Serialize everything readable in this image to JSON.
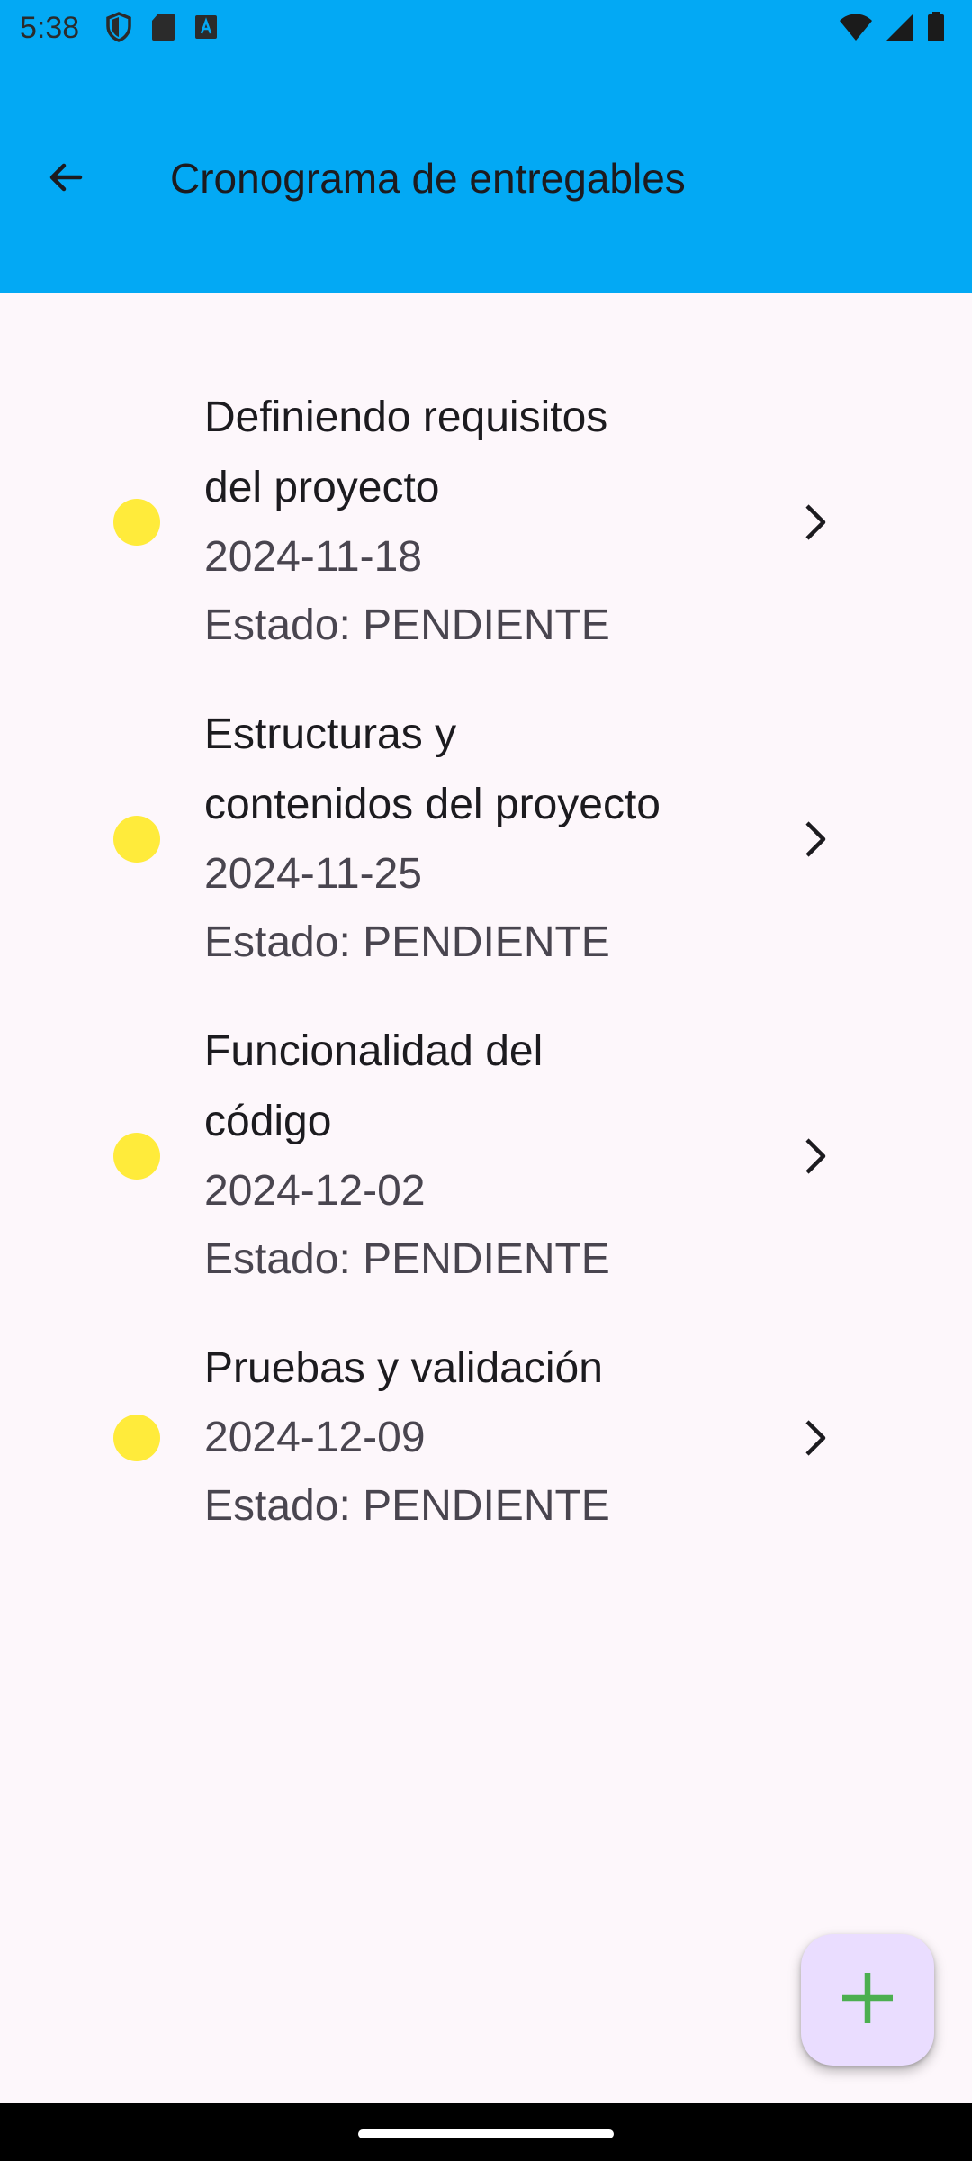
{
  "status_bar": {
    "time": "5:38",
    "left_icons": [
      "shield-icon",
      "sd-card-icon",
      "text-a-icon"
    ],
    "right_icons": [
      "wifi-icon",
      "cell-signal-icon",
      "battery-icon"
    ]
  },
  "app_bar": {
    "title": "Cronograma de entregables",
    "back_icon": "arrow-back-icon",
    "background_color": "#03a9f4"
  },
  "deliverables": [
    {
      "title_lines": [
        "Definiendo requisitos",
        "del proyecto"
      ],
      "date": "2024-11-18",
      "status": "Estado: PENDIENTE",
      "indicator_color": "#ffeb3b"
    },
    {
      "title_lines": [
        "Estructuras y",
        "contenidos del proyecto"
      ],
      "date": "2024-11-25",
      "status": "Estado: PENDIENTE",
      "indicator_color": "#ffeb3b"
    },
    {
      "title_lines": [
        "Funcionalidad del",
        "código"
      ],
      "date": "2024-12-02",
      "status": "Estado: PENDIENTE",
      "indicator_color": "#ffeb3b"
    },
    {
      "title_lines": [
        "Pruebas y validación"
      ],
      "date": "2024-12-09",
      "status": "Estado: PENDIENTE",
      "indicator_color": "#ffeb3b"
    }
  ],
  "fab": {
    "icon": "plus-icon",
    "background_color": "#eaddff",
    "icon_color": "#4caf50"
  }
}
